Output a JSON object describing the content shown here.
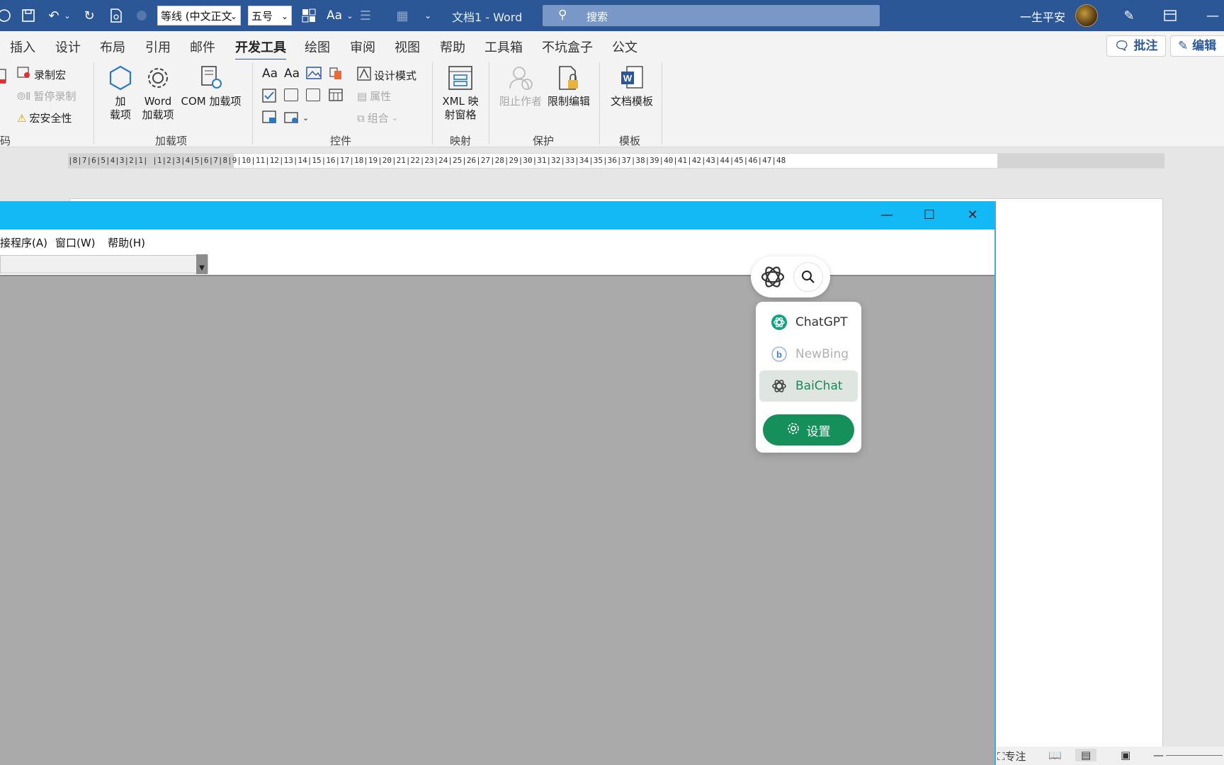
{
  "titlebar": {
    "font_name": "等线 (中文正文",
    "font_size": "五号",
    "doc_title": "文档1  -  Word",
    "search_placeholder": "搜索",
    "user_name": "一生平安"
  },
  "tabs": [
    "插入",
    "设计",
    "布局",
    "引用",
    "邮件",
    "开发工具",
    "绘图",
    "审阅",
    "视图",
    "帮助",
    "工具箱",
    "不坑盒子",
    "公文"
  ],
  "tab_active": "开发工具",
  "right_buttons": {
    "comment": "批注",
    "edit": "编辑"
  },
  "ribbon": {
    "code": {
      "label": "码",
      "record_macro": "录制宏",
      "pause_recording": "暂停录制",
      "macro_security": "宏安全性"
    },
    "addins": {
      "label": "加载项",
      "addin": "加\n载项",
      "word_addin": "Word\n加载项",
      "com_addin": "COM 加载项"
    },
    "controls": {
      "label": "控件",
      "design_mode": "设计模式",
      "properties": "属性",
      "group": "组合"
    },
    "mapping": {
      "label": "映射",
      "xml_pane": "XML 映\n射窗格"
    },
    "protect": {
      "label": "保护",
      "block_authors": "阻止作者",
      "restrict_edit": "限制编辑"
    },
    "templates": {
      "label": "模板",
      "doc_template": "文档模板"
    }
  },
  "ruler": {
    "text": "|8|7|6|5|4|3|2|1|   |1|2|3|4|5|6|7|8|9|10|11|12|13|14|15|16|17|18|19|20|21|22|23|24|25|26|27|28|29|30|31|32|33|34|35|36|37|38|39|40|41|42|43|44|45|46|47|48"
  },
  "app_window": {
    "menu": [
      "接程序(A)",
      "窗口(W)",
      "帮助(H)"
    ],
    "controls": {
      "minimize": "—",
      "maximize": "☐",
      "close": "✕"
    }
  },
  "ai_popup": {
    "items": [
      {
        "label": "ChatGPT",
        "state": "normal"
      },
      {
        "label": "NewBing",
        "state": "disabled"
      },
      {
        "label": "BaiChat",
        "state": "selected"
      }
    ],
    "settings_label": "设置",
    "colors": {
      "accent": "#16905a",
      "chatgpt": "#10a37f"
    }
  },
  "statusbar": {
    "focus": "专注"
  }
}
